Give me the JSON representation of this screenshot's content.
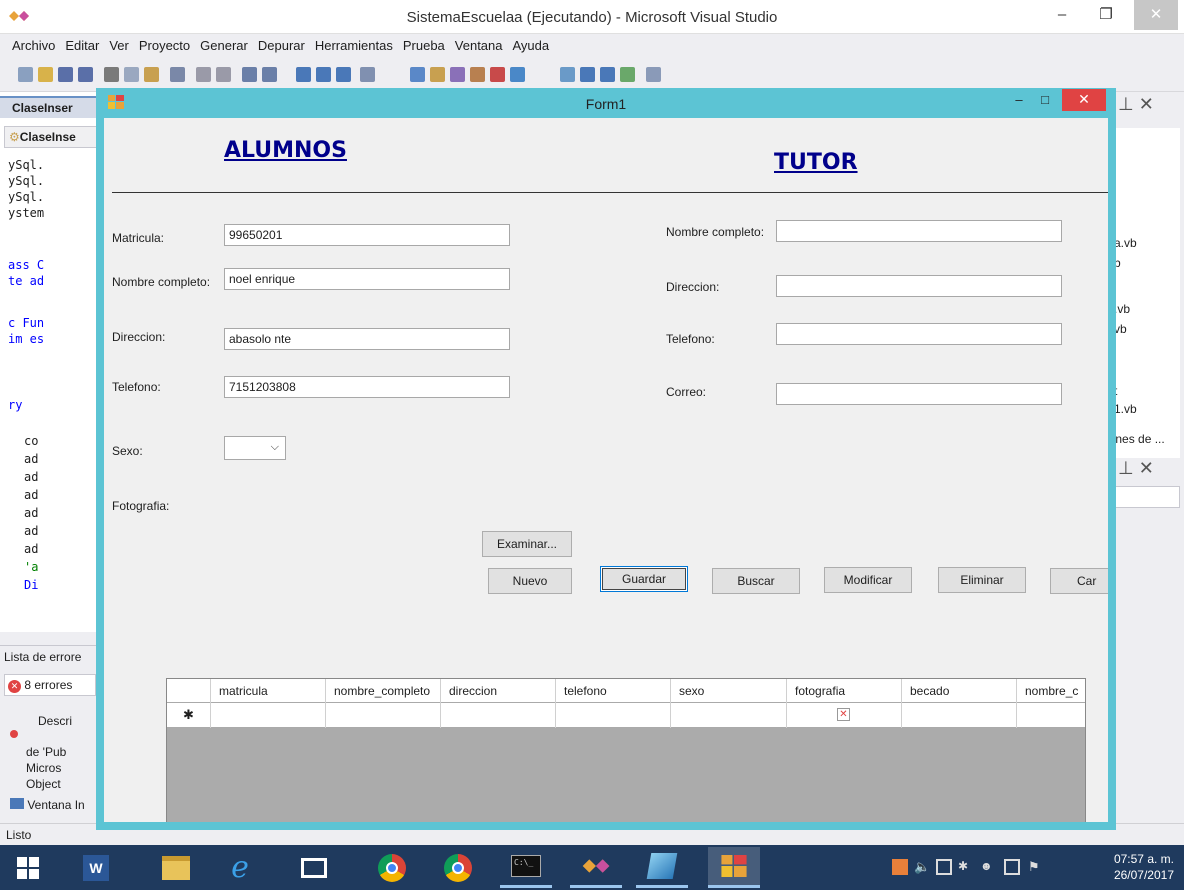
{
  "vs": {
    "title": "SistemaEscuelaa (Ejecutando) - Microsoft Visual Studio",
    "menu": [
      "Archivo",
      "Editar",
      "Ver",
      "Proyecto",
      "Generar",
      "Depurar",
      "Herramientas",
      "Prueba",
      "Ventana",
      "Ayuda"
    ],
    "editor_tab": "ClaseInser",
    "editor_subtab": "ClaseInse",
    "code_lines": [
      "ySql.",
      "ySql.",
      "ySql.",
      "ystem",
      "ass C",
      "te ad",
      "c Fun",
      "im es",
      "ry",
      "co",
      "ad",
      "ad",
      "ad",
      "ad",
      "ad",
      "ad",
      "'a",
      "Di"
    ],
    "error_panel_title": "Lista de errore",
    "error_count": "8 errores",
    "error_col": "Descri",
    "error_text": [
      "de 'Pub",
      "Micros",
      "Object"
    ],
    "immediate_tab": "Ventana In",
    "status": "Listo",
    "right_items": [
      "a.vb",
      "b",
      ".vb",
      "vb",
      "t",
      "1.vb",
      "genes de ..."
    ]
  },
  "form": {
    "title": "Form1",
    "heading_left": "ALUMNOS",
    "heading_right": "TUTOR",
    "alumno": {
      "matricula_label": "Matricula:",
      "matricula_value": "99650201",
      "nombre_label": "Nombre completo:",
      "nombre_value": "noel enrique",
      "direccion_label": "Direccion:",
      "direccion_value": "abasolo nte",
      "telefono_label": "Telefono:",
      "telefono_value": "7151203808",
      "sexo_label": "Sexo:",
      "sexo_value": "",
      "fotografia_label": "Fotografia:"
    },
    "tutor": {
      "nombre_label": "Nombre completo:",
      "nombre_value": "",
      "direccion_label": "Direccion:",
      "direccion_value": "",
      "telefono_label": "Telefono:",
      "telefono_value": "",
      "correo_label": "Correo:",
      "correo_value": ""
    },
    "buttons": {
      "examinar": "Examinar...",
      "nuevo": "Nuevo",
      "guardar": "Guardar",
      "buscar": "Buscar",
      "modificar": "Modificar",
      "eliminar": "Eliminar",
      "cancelar": "Car"
    },
    "grid": {
      "columns": [
        "matricula",
        "nombre_completo",
        "direccion",
        "telefono",
        "sexo",
        "fotografia",
        "becado",
        "nombre_c"
      ],
      "new_row_marker": "✱"
    }
  },
  "taskbar": {
    "time": "07:57 a. m.",
    "date": "26/07/2017"
  },
  "colors": {
    "form_border": "#5cc4d4",
    "heading": "#00008b",
    "taskbar": "#1f3a5e",
    "close_red": "#e04343"
  }
}
